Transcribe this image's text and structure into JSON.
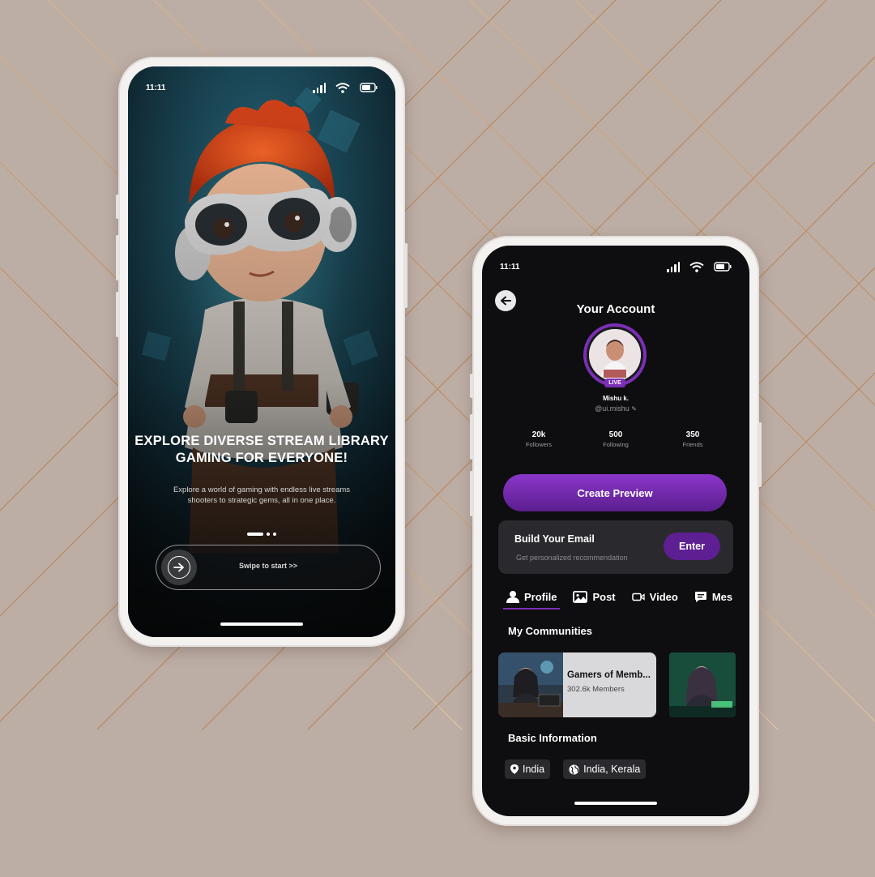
{
  "onboarding": {
    "status_time": "11:11",
    "title_line1": "EXPLORE DIVERSE STREAM LIBRARY",
    "title_line2": "GAMING FOR EVERYONE!",
    "subtitle_line1": "Explore a world of gaming with endless live streams",
    "subtitle_line2": "shooters to strategic gems, all in one place.",
    "pager": {
      "count": 3,
      "active": 0
    },
    "swipe_label": "Swipe to start >>"
  },
  "account": {
    "status_time": "11:11",
    "title": "Your Account",
    "live_badge": "LIVE",
    "name": "Mishu k.",
    "handle": "@ui.mishu",
    "stats": [
      {
        "value": "20k",
        "label": "Followers"
      },
      {
        "value": "500",
        "label": "Following"
      },
      {
        "value": "350",
        "label": "Friends"
      }
    ],
    "cta_label": "Create Preview",
    "email_card": {
      "title": "Build Your Email",
      "subtitle": "Get personalized recommendation",
      "button": "Enter"
    },
    "tabs": [
      {
        "label": "Profile",
        "icon": "user-icon",
        "active": true
      },
      {
        "label": "Post",
        "icon": "image-icon",
        "active": false
      },
      {
        "label": "Video",
        "icon": "video-icon",
        "active": false
      },
      {
        "label": "Mes",
        "icon": "message-icon",
        "active": false
      }
    ],
    "communities_title": "My Communities",
    "community": {
      "name": "Gamers of Memb...",
      "members": "302.6k Members"
    },
    "basic_info_title": "Basic Information",
    "chips": [
      {
        "label": "India",
        "icon": "location-pin-icon"
      },
      {
        "label": "India, Kerala",
        "icon": "globe-icon"
      }
    ]
  },
  "colors": {
    "background": "#bdaea5",
    "accent_purple": "#7b2fb6",
    "gold_lines": "#c49a6c"
  }
}
